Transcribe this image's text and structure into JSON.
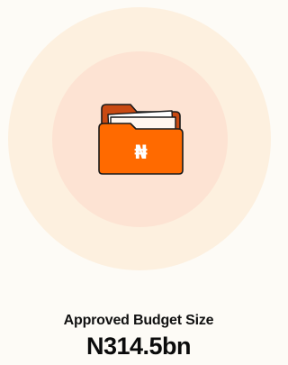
{
  "stat": {
    "label": "Approved Budget Size",
    "value": "N314.5bn"
  },
  "icon": {
    "name": "naira-folder-icon",
    "symbol": "₦"
  },
  "colors": {
    "background": "#fdfbf6",
    "outer_ring": "#fdf0df",
    "inner_ring": "#fde3d3",
    "folder_front": "#ff6a00",
    "folder_back": "#c94a12",
    "folder_outline": "#1a1a1a",
    "paper": "#ffffff",
    "text": "#111111"
  }
}
